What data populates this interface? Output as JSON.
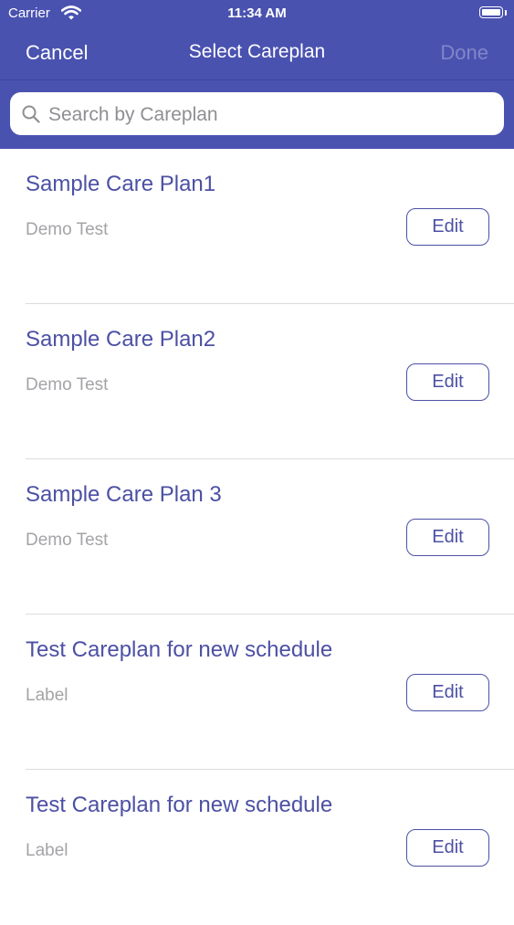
{
  "status_bar": {
    "carrier": "Carrier",
    "time": "11:34 AM"
  },
  "nav": {
    "cancel_label": "Cancel",
    "title": "Select Careplan",
    "done_label": "Done"
  },
  "search": {
    "placeholder": "Search by Careplan",
    "value": ""
  },
  "careplans": [
    {
      "title": "Sample Care Plan1",
      "subtitle": "Demo Test",
      "edit_label": "Edit"
    },
    {
      "title": "Sample Care Plan2",
      "subtitle": "Demo Test",
      "edit_label": "Edit"
    },
    {
      "title": "Sample Care Plan 3",
      "subtitle": "Demo Test",
      "edit_label": "Edit"
    },
    {
      "title": "Test Careplan for new schedule",
      "subtitle": "Label",
      "edit_label": "Edit"
    },
    {
      "title": "Test Careplan for new schedule",
      "subtitle": "Label",
      "edit_label": "Edit"
    }
  ],
  "colors": {
    "nav_background": "#4a52b0",
    "accent": "#4c50a4",
    "subtitle": "#a4a4a8",
    "done_disabled": "#7f86c9"
  },
  "icons": {
    "wifi": "wifi-icon",
    "battery": "battery-icon",
    "search": "search-icon"
  }
}
